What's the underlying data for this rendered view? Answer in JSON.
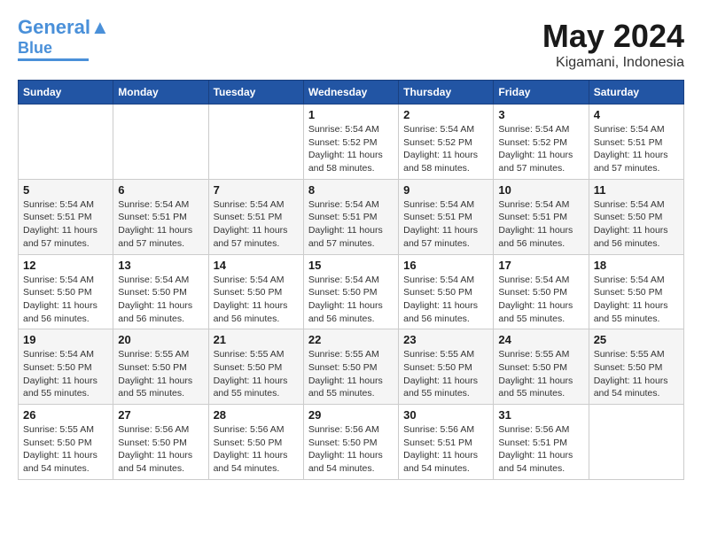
{
  "header": {
    "logo_line1": "General",
    "logo_line2": "Blue",
    "month": "May 2024",
    "location": "Kigamani, Indonesia"
  },
  "weekdays": [
    "Sunday",
    "Monday",
    "Tuesday",
    "Wednesday",
    "Thursday",
    "Friday",
    "Saturday"
  ],
  "weeks": [
    [
      {
        "day": "",
        "info": ""
      },
      {
        "day": "",
        "info": ""
      },
      {
        "day": "",
        "info": ""
      },
      {
        "day": "1",
        "info": "Sunrise: 5:54 AM\nSunset: 5:52 PM\nDaylight: 11 hours\nand 58 minutes."
      },
      {
        "day": "2",
        "info": "Sunrise: 5:54 AM\nSunset: 5:52 PM\nDaylight: 11 hours\nand 58 minutes."
      },
      {
        "day": "3",
        "info": "Sunrise: 5:54 AM\nSunset: 5:52 PM\nDaylight: 11 hours\nand 57 minutes."
      },
      {
        "day": "4",
        "info": "Sunrise: 5:54 AM\nSunset: 5:51 PM\nDaylight: 11 hours\nand 57 minutes."
      }
    ],
    [
      {
        "day": "5",
        "info": "Sunrise: 5:54 AM\nSunset: 5:51 PM\nDaylight: 11 hours\nand 57 minutes."
      },
      {
        "day": "6",
        "info": "Sunrise: 5:54 AM\nSunset: 5:51 PM\nDaylight: 11 hours\nand 57 minutes."
      },
      {
        "day": "7",
        "info": "Sunrise: 5:54 AM\nSunset: 5:51 PM\nDaylight: 11 hours\nand 57 minutes."
      },
      {
        "day": "8",
        "info": "Sunrise: 5:54 AM\nSunset: 5:51 PM\nDaylight: 11 hours\nand 57 minutes."
      },
      {
        "day": "9",
        "info": "Sunrise: 5:54 AM\nSunset: 5:51 PM\nDaylight: 11 hours\nand 57 minutes."
      },
      {
        "day": "10",
        "info": "Sunrise: 5:54 AM\nSunset: 5:51 PM\nDaylight: 11 hours\nand 56 minutes."
      },
      {
        "day": "11",
        "info": "Sunrise: 5:54 AM\nSunset: 5:50 PM\nDaylight: 11 hours\nand 56 minutes."
      }
    ],
    [
      {
        "day": "12",
        "info": "Sunrise: 5:54 AM\nSunset: 5:50 PM\nDaylight: 11 hours\nand 56 minutes."
      },
      {
        "day": "13",
        "info": "Sunrise: 5:54 AM\nSunset: 5:50 PM\nDaylight: 11 hours\nand 56 minutes."
      },
      {
        "day": "14",
        "info": "Sunrise: 5:54 AM\nSunset: 5:50 PM\nDaylight: 11 hours\nand 56 minutes."
      },
      {
        "day": "15",
        "info": "Sunrise: 5:54 AM\nSunset: 5:50 PM\nDaylight: 11 hours\nand 56 minutes."
      },
      {
        "day": "16",
        "info": "Sunrise: 5:54 AM\nSunset: 5:50 PM\nDaylight: 11 hours\nand 56 minutes."
      },
      {
        "day": "17",
        "info": "Sunrise: 5:54 AM\nSunset: 5:50 PM\nDaylight: 11 hours\nand 55 minutes."
      },
      {
        "day": "18",
        "info": "Sunrise: 5:54 AM\nSunset: 5:50 PM\nDaylight: 11 hours\nand 55 minutes."
      }
    ],
    [
      {
        "day": "19",
        "info": "Sunrise: 5:54 AM\nSunset: 5:50 PM\nDaylight: 11 hours\nand 55 minutes."
      },
      {
        "day": "20",
        "info": "Sunrise: 5:55 AM\nSunset: 5:50 PM\nDaylight: 11 hours\nand 55 minutes."
      },
      {
        "day": "21",
        "info": "Sunrise: 5:55 AM\nSunset: 5:50 PM\nDaylight: 11 hours\nand 55 minutes."
      },
      {
        "day": "22",
        "info": "Sunrise: 5:55 AM\nSunset: 5:50 PM\nDaylight: 11 hours\nand 55 minutes."
      },
      {
        "day": "23",
        "info": "Sunrise: 5:55 AM\nSunset: 5:50 PM\nDaylight: 11 hours\nand 55 minutes."
      },
      {
        "day": "24",
        "info": "Sunrise: 5:55 AM\nSunset: 5:50 PM\nDaylight: 11 hours\nand 55 minutes."
      },
      {
        "day": "25",
        "info": "Sunrise: 5:55 AM\nSunset: 5:50 PM\nDaylight: 11 hours\nand 54 minutes."
      }
    ],
    [
      {
        "day": "26",
        "info": "Sunrise: 5:55 AM\nSunset: 5:50 PM\nDaylight: 11 hours\nand 54 minutes."
      },
      {
        "day": "27",
        "info": "Sunrise: 5:56 AM\nSunset: 5:50 PM\nDaylight: 11 hours\nand 54 minutes."
      },
      {
        "day": "28",
        "info": "Sunrise: 5:56 AM\nSunset: 5:50 PM\nDaylight: 11 hours\nand 54 minutes."
      },
      {
        "day": "29",
        "info": "Sunrise: 5:56 AM\nSunset: 5:50 PM\nDaylight: 11 hours\nand 54 minutes."
      },
      {
        "day": "30",
        "info": "Sunrise: 5:56 AM\nSunset: 5:51 PM\nDaylight: 11 hours\nand 54 minutes."
      },
      {
        "day": "31",
        "info": "Sunrise: 5:56 AM\nSunset: 5:51 PM\nDaylight: 11 hours\nand 54 minutes."
      },
      {
        "day": "",
        "info": ""
      }
    ]
  ]
}
